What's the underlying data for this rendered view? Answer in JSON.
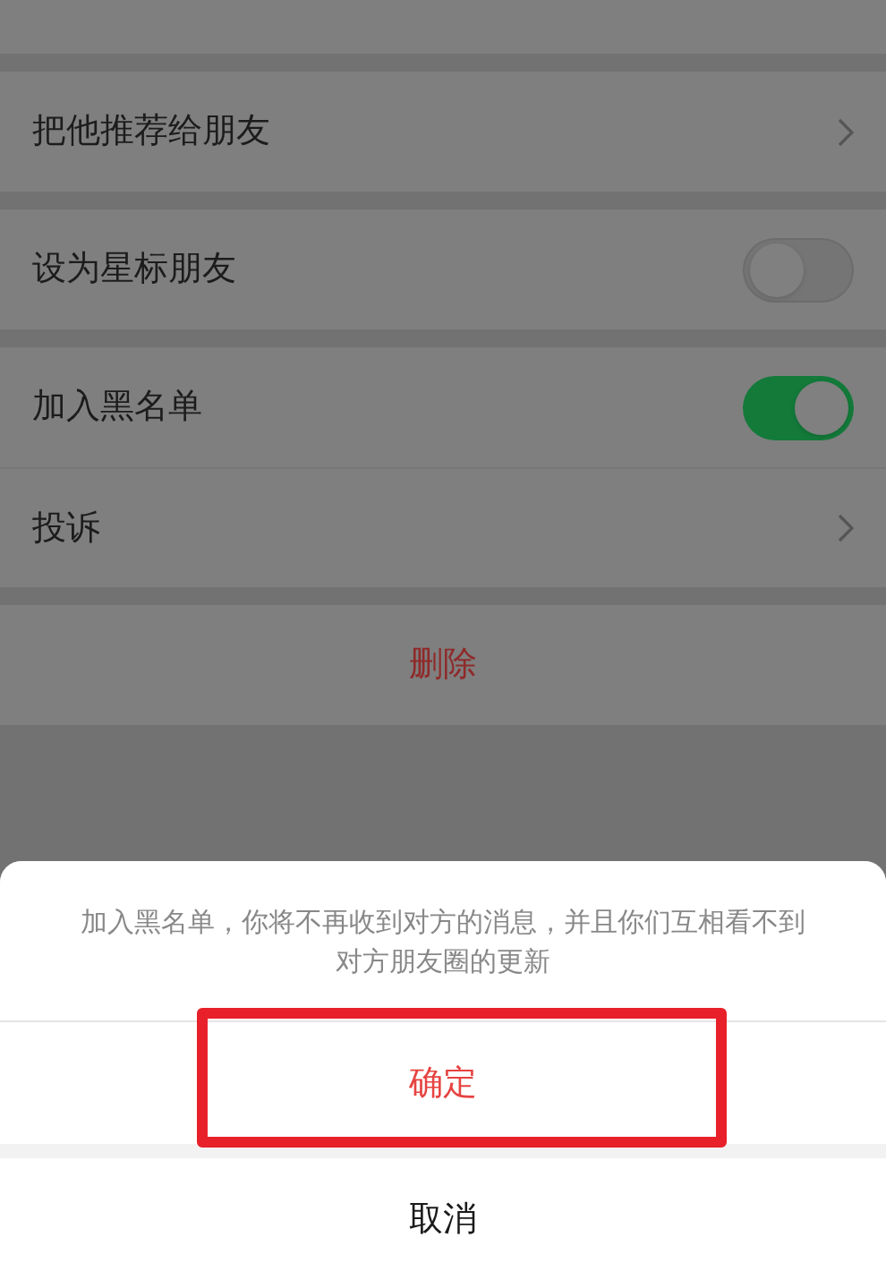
{
  "groups": [
    {
      "rows": [
        {
          "kind": "link",
          "label": "把他推荐给朋友"
        }
      ]
    },
    {
      "rows": [
        {
          "kind": "toggle",
          "label": "设为星标朋友",
          "on": false
        }
      ]
    },
    {
      "rows": [
        {
          "kind": "toggle",
          "label": "加入黑名单",
          "on": true
        },
        {
          "kind": "link",
          "label": "投诉"
        }
      ]
    },
    {
      "rows": [
        {
          "kind": "danger",
          "label": "删除"
        }
      ]
    }
  ],
  "action_sheet": {
    "message": "加入黑名单，你将不再收到对方的消息，并且你们互相看不到对方朋友圈的更新",
    "actions": [
      {
        "kind": "confirm",
        "label": "确定",
        "annotated": true
      },
      {
        "kind": "cancel",
        "label": "取消",
        "annotated": false
      }
    ]
  }
}
